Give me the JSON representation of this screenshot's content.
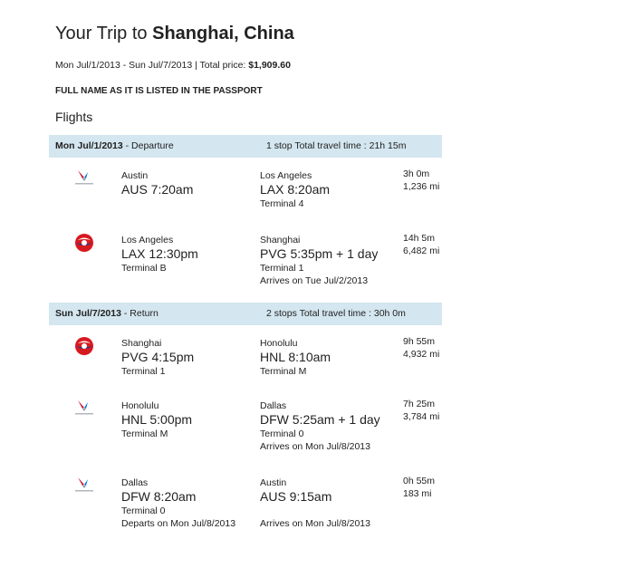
{
  "header": {
    "title_prefix": "Your Trip to",
    "title_dest": "Shanghai, China",
    "dates": "Mon Jul/1/2013 - Sun Jul/7/2013 | Total price:",
    "price": "$1,909.60",
    "fullname_label": "FULL NAME AS IT IS LISTED IN THE PASSPORT",
    "flights_heading": "Flights"
  },
  "departure": {
    "date": "Mon Jul/1/2013",
    "label": "- Departure",
    "info": "1 stop Total travel time : 21h 15m",
    "segments": [
      {
        "airline_icon": "american-airlines-icon",
        "dep_city": "Austin",
        "dep_time": "AUS 7:20am",
        "dep_terminal": "",
        "dep_note": "",
        "arr_city": "Los Angeles",
        "arr_time": "LAX 8:20am",
        "arr_terminal": "Terminal 4",
        "arr_note": "",
        "duration": "3h 0m",
        "distance": "1,236 mi"
      },
      {
        "airline_icon": "china-eastern-icon",
        "dep_city": "Los Angeles",
        "dep_time": "LAX 12:30pm",
        "dep_terminal": "Terminal B",
        "dep_note": "",
        "arr_city": "Shanghai",
        "arr_time": "PVG 5:35pm + 1 day",
        "arr_terminal": "Terminal 1",
        "arr_note": "Arrives on Tue Jul/2/2013",
        "duration": "14h 5m",
        "distance": "6,482 mi"
      }
    ]
  },
  "return": {
    "date": "Sun Jul/7/2013",
    "label": "- Return",
    "info": "2 stops Total travel time : 30h 0m",
    "segments": [
      {
        "airline_icon": "china-eastern-icon",
        "dep_city": "Shanghai",
        "dep_time": "PVG 4:15pm",
        "dep_terminal": "Terminal 1",
        "dep_note": "",
        "arr_city": "Honolulu",
        "arr_time": "HNL 8:10am",
        "arr_terminal": "Terminal M",
        "arr_note": "",
        "duration": "9h 55m",
        "distance": "4,932 mi"
      },
      {
        "airline_icon": "american-airlines-icon",
        "dep_city": "Honolulu",
        "dep_time": "HNL 5:00pm",
        "dep_terminal": "Terminal M",
        "dep_note": "",
        "arr_city": "Dallas",
        "arr_time": "DFW 5:25am + 1 day",
        "arr_terminal": "Terminal 0",
        "arr_note": "Arrives on Mon Jul/8/2013",
        "duration": "7h 25m",
        "distance": "3,784 mi"
      },
      {
        "airline_icon": "american-airlines-icon",
        "dep_city": "Dallas",
        "dep_time": "DFW 8:20am",
        "dep_terminal": "Terminal 0",
        "dep_note": "Departs on Mon Jul/8/2013",
        "arr_city": "Austin",
        "arr_time": "AUS 9:15am",
        "arr_terminal": "",
        "arr_note": "Arrives on Mon Jul/8/2013",
        "duration": "0h 55m",
        "distance": "183 mi"
      }
    ]
  }
}
